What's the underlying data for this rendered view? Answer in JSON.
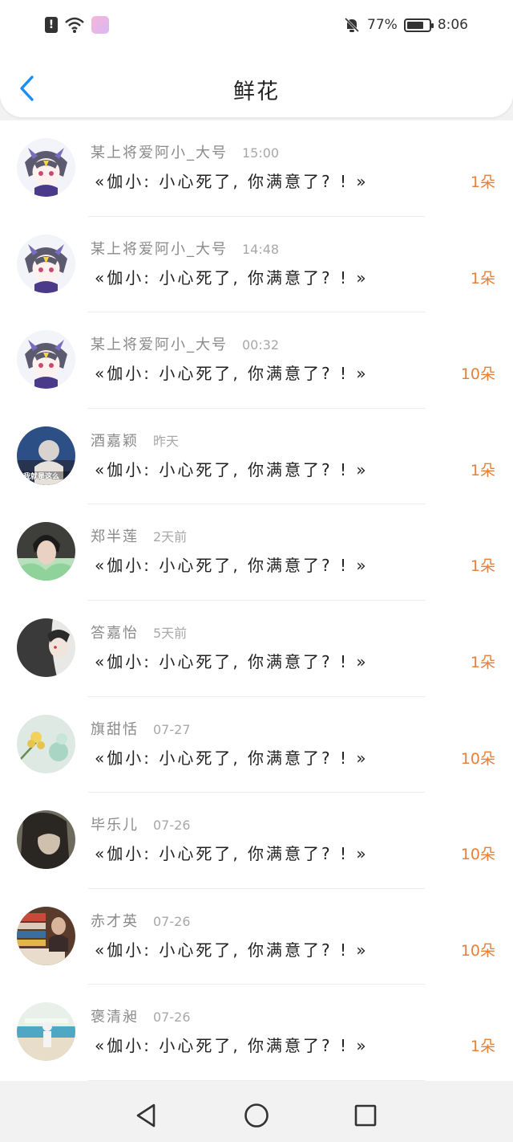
{
  "status_bar": {
    "battery_percent_label": "77%",
    "battery_level": 0.77,
    "time": "8:06",
    "icons": [
      "alert-icon",
      "wifi-icon",
      "app-icon",
      "mute-bell-icon",
      "battery-icon"
    ]
  },
  "header": {
    "title": "鲜花",
    "back_icon": "chevron-left-icon"
  },
  "colors": {
    "accent": "#1a8ff0",
    "count": "#e5803a",
    "muted": "#8a8a8a"
  },
  "items": [
    {
      "name": "某上将爱阿小_大号",
      "time": "15:00",
      "message": "«伽小: 小心死了, 你满意了? ! »",
      "count": "1朵",
      "avatar": "anime"
    },
    {
      "name": "某上将爱阿小_大号",
      "time": "14:48",
      "message": "«伽小: 小心死了, 你满意了? ! »",
      "count": "1朵",
      "avatar": "anime"
    },
    {
      "name": "某上将爱阿小_大号",
      "time": "00:32",
      "message": "«伽小: 小心死了, 你满意了? ! »",
      "count": "10朵",
      "avatar": "anime"
    },
    {
      "name": "酒嘉颖",
      "time": "昨天",
      "message": "«伽小: 小心死了, 你满意了? ! »",
      "count": "1朵",
      "avatar": "photo-blue",
      "avatar_caption": "我就是这么"
    },
    {
      "name": "郑半莲",
      "time": "2天前",
      "message": "«伽小: 小心死了, 你满意了? ! »",
      "count": "1朵",
      "avatar": "photo-green"
    },
    {
      "name": "答嘉怡",
      "time": "5天前",
      "message": "«伽小: 小心死了, 你满意了? ! »",
      "count": "1朵",
      "avatar": "photo-gray"
    },
    {
      "name": "旗甜恬",
      "time": "07-27",
      "message": "«伽小: 小心死了, 你满意了? ! »",
      "count": "10朵",
      "avatar": "photo-flower"
    },
    {
      "name": "毕乐儿",
      "time": "07-26",
      "message": "«伽小: 小心死了, 你满意了? ! »",
      "count": "10朵",
      "avatar": "photo-dark"
    },
    {
      "name": "赤才英",
      "time": "07-26",
      "message": "«伽小: 小心死了, 你满意了? ! »",
      "count": "10朵",
      "avatar": "photo-books"
    },
    {
      "name": "褒清昶",
      "time": "07-26",
      "message": "«伽小: 小心死了, 你满意了? ! »",
      "count": "1朵",
      "avatar": "photo-beach"
    }
  ],
  "system_nav": {
    "back_icon": "triangle-back-icon",
    "home_icon": "circle-home-icon",
    "recent_icon": "square-recent-icon"
  }
}
